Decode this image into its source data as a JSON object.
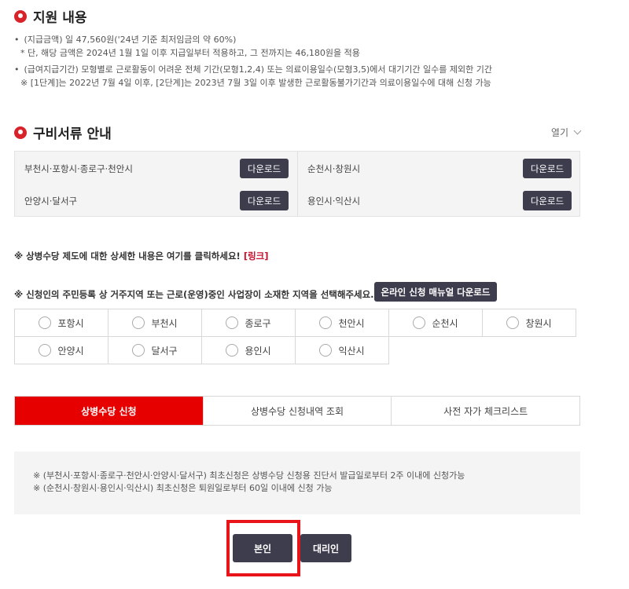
{
  "support": {
    "title": "지원 내용",
    "bullet1": "(지급금액) 일 47,560원('24년 기준 최저임금의 약 60%)",
    "bullet1_sub": "* 단, 해당 금액은 2024년 1월 1일 이후 지급일부터 적용하고, 그 전까지는 46,180원을 적용",
    "bullet2": "(급여지급기간) 모형별로 근로활동이 어려운 전체 기간(모형1,2,4) 또는 의료이용일수(모형3,5)에서 대기기간 일수를 제외한 기간",
    "bullet2_sub": "※ [1단계]는 2022년 7월 4일 이후, [2단계]는 2023년 7월 3일 이후 발생한 근로활동불가기간과 의료이용일수에 대해 신청 가능"
  },
  "documents": {
    "title": "구비서류 안내",
    "toggle_label": "열기",
    "items": [
      {
        "region": "부천시·포항시·종로구·천안시",
        "button": "다운로드"
      },
      {
        "region": "순천시·창원시",
        "button": "다운로드"
      },
      {
        "region": "안양시·달서구",
        "button": "다운로드"
      },
      {
        "region": "용인시·익산시",
        "button": "다운로드"
      }
    ]
  },
  "notice": {
    "text": "※ 상병수당 제도에 대한 상세한 내용은 여기를 클릭하세요!",
    "link": "[링크]"
  },
  "region_select": {
    "question": "※ 신청인의 주민등록 상 거주지역 또는 근로(운영)중인 사업장이 소재한 지역을 선택해주세요.",
    "manual_button": "온라인 신청 매뉴얼 다운로드",
    "options": [
      "포항시",
      "부천시",
      "종로구",
      "천안시",
      "순천시",
      "창원시",
      "안양시",
      "달서구",
      "용인시",
      "익산시"
    ]
  },
  "tabs": [
    "상병수당 신청",
    "상병수당 신청내역 조회",
    "사전 자가 체크리스트"
  ],
  "notes": {
    "line1": "※ (부천시·포항시·종로구·천안시·안양시·달서구) 최초신청은 상병수당 신청용 진단서 발급일로부터 2주 이내에 신청가능",
    "line2": "※ (순천시·창원시·용인시·익산시) 최초신청은 퇴원일로부터 60일 이내에 신청 가능"
  },
  "actions": {
    "self": "본인",
    "proxy": "대리인"
  },
  "colors": {
    "accent": "#e60000",
    "button_dark": "#3d3d4e",
    "highlight_box": "#e8141a"
  }
}
